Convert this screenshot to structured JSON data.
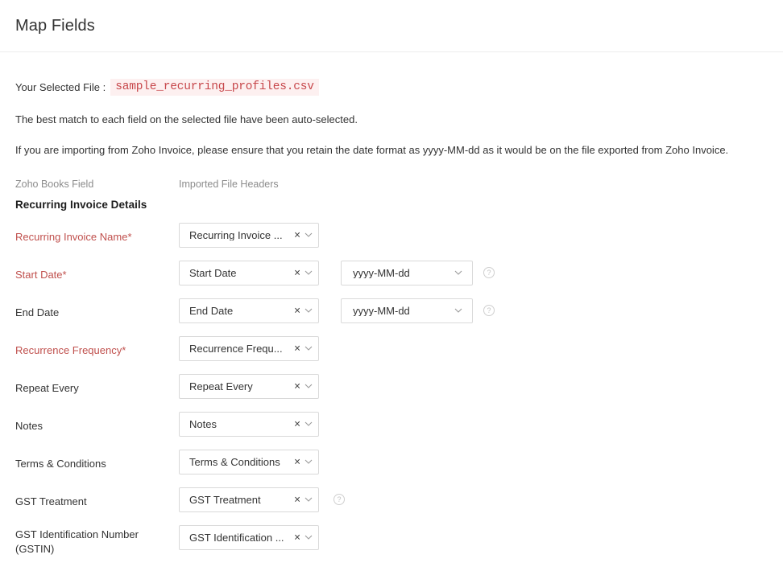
{
  "header": {
    "title": "Map Fields"
  },
  "file_info": {
    "label": "Your Selected File :",
    "filename": "sample_recurring_profiles.csv"
  },
  "instructions": [
    "The best match to each field on the selected file have been auto-selected.",
    "If you are importing from Zoho Invoice, please ensure that you retain the date format as yyyy-MM-dd as it would be on the file exported from Zoho Invoice."
  ],
  "columns": {
    "left": "Zoho Books Field",
    "right": "Imported File Headers"
  },
  "section": {
    "title": "Recurring Invoice Details"
  },
  "icons": {
    "clear": "×",
    "help": "?"
  },
  "rows": [
    {
      "label": "Recurring Invoice Name",
      "required": true,
      "mapped_value": "Recurring Invoice ...",
      "has_format": false,
      "has_help": false
    },
    {
      "label": "Start Date",
      "required": true,
      "mapped_value": "Start Date",
      "has_format": true,
      "format_value": "yyyy-MM-dd",
      "has_help": true
    },
    {
      "label": "End Date",
      "required": false,
      "mapped_value": "End Date",
      "has_format": true,
      "format_value": "yyyy-MM-dd",
      "has_help": true
    },
    {
      "label": "Recurrence Frequency",
      "required": true,
      "mapped_value": "Recurrence Frequ...",
      "has_format": false,
      "has_help": false
    },
    {
      "label": "Repeat Every",
      "required": false,
      "mapped_value": "Repeat Every",
      "has_format": false,
      "has_help": false
    },
    {
      "label": "Notes",
      "required": false,
      "mapped_value": "Notes",
      "has_format": false,
      "has_help": false
    },
    {
      "label": "Terms & Conditions",
      "required": false,
      "mapped_value": "Terms & Conditions",
      "has_format": false,
      "has_help": false
    },
    {
      "label": "GST Treatment",
      "required": false,
      "mapped_value": "GST Treatment",
      "has_format": false,
      "has_help": true
    },
    {
      "label": "GST Identification Number (GSTIN)",
      "label_lines": [
        "GST Identification Number",
        "(GSTIN)"
      ],
      "required": false,
      "mapped_value": "GST Identification ...",
      "has_format": false,
      "has_help": false
    }
  ],
  "colors": {
    "required_label": "#c0504d",
    "filename_text": "#c7474b",
    "filename_bg": "#fdf0f0",
    "border": "#d9d9d9"
  }
}
